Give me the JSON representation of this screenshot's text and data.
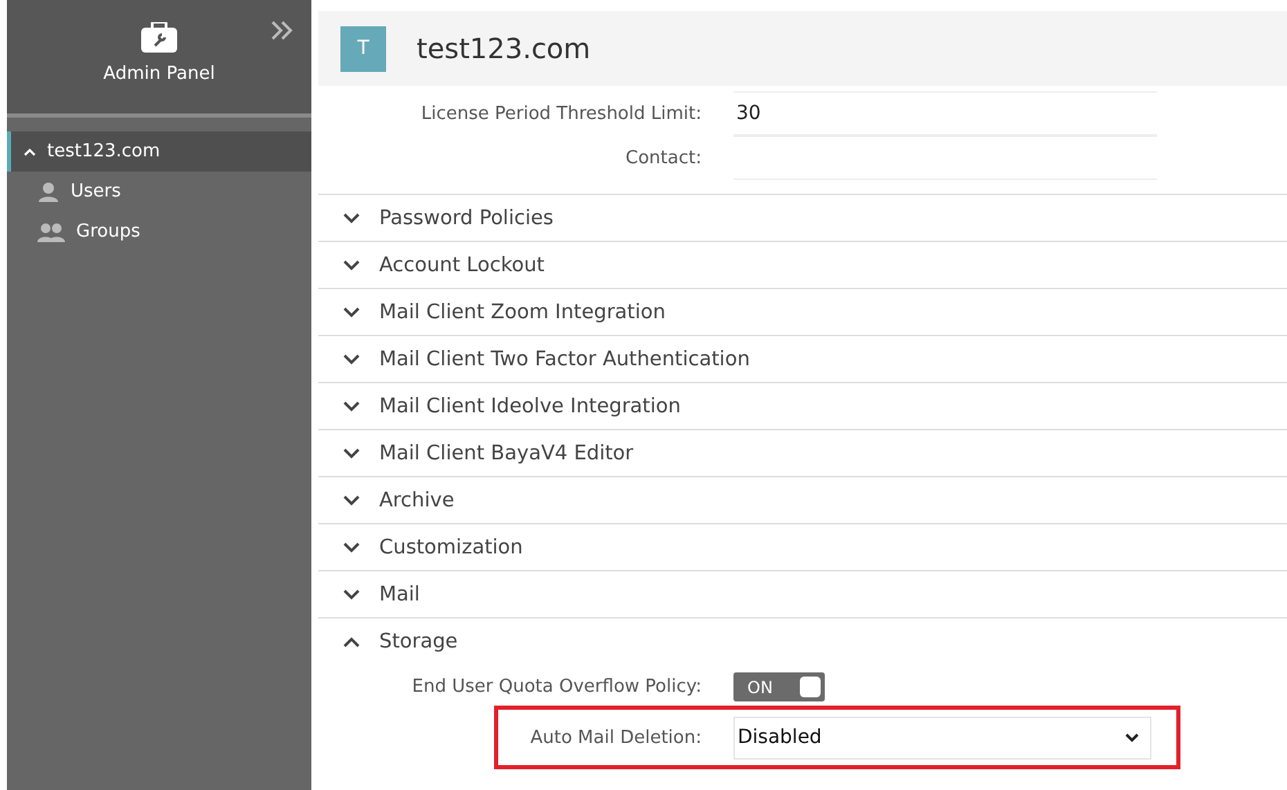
{
  "sidebar": {
    "title": "Admin Panel",
    "tree": [
      {
        "label": "test123.com",
        "expanded": true,
        "selected": true,
        "children": [
          {
            "label": "Users",
            "kind": "user"
          },
          {
            "label": "Groups",
            "kind": "group"
          }
        ]
      }
    ]
  },
  "header": {
    "avatar": "T",
    "title": "test123.com"
  },
  "fields": [
    {
      "label": "License Period Threshold Limit:",
      "value": "30"
    },
    {
      "label": "Contact:"
    }
  ],
  "sections": [
    {
      "label": "Password Policies",
      "expanded": false
    },
    {
      "label": "Account Lockout",
      "expanded": false
    },
    {
      "label": "Mail Client Zoom Integration",
      "expanded": false
    },
    {
      "label": "Mail Client Two Factor Authentication",
      "expanded": false
    },
    {
      "label": "Mail Client Ideolve Integration",
      "expanded": false
    },
    {
      "label": "Mail Client BayaV4 Editor",
      "expanded": false
    },
    {
      "label": "Archive",
      "expanded": false
    },
    {
      "label": "Customization",
      "expanded": false
    },
    {
      "label": "Mail",
      "expanded": false
    },
    {
      "label": "Storage",
      "expanded": true,
      "settings": [
        {
          "kind": "toggle",
          "label": "End User Quota Overflow Policy:",
          "on": true,
          "text": "ON",
          "highlighted": false
        },
        {
          "kind": "select",
          "label": "Auto Mail Deletion:",
          "value": "Disabled",
          "highlighted": true
        }
      ]
    }
  ]
}
